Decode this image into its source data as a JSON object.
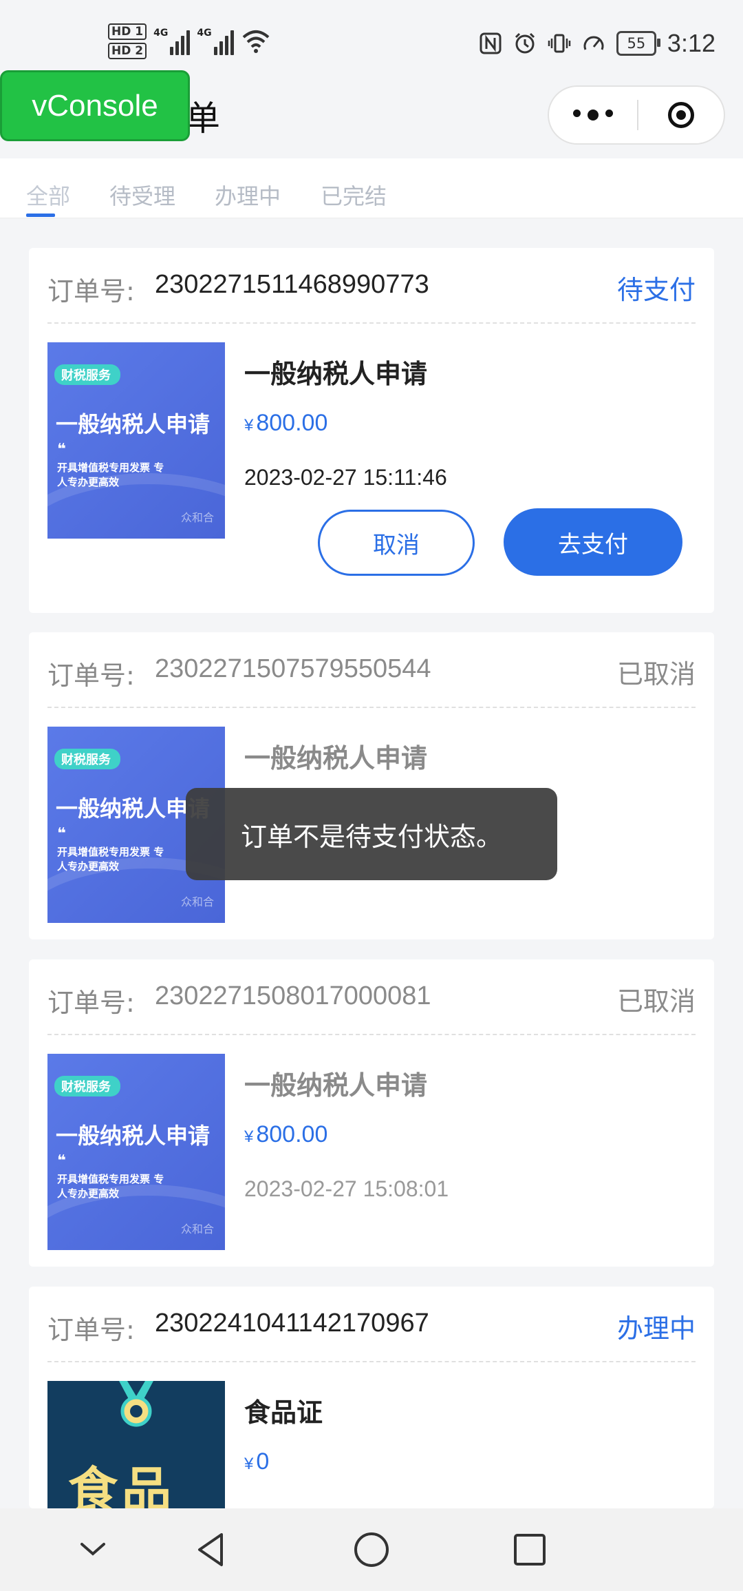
{
  "statusbar": {
    "hd1": "HD 1",
    "hd2": "HD 2",
    "net1": "4G",
    "net2": "4G",
    "battery": "55",
    "time": "3:12",
    "icons": [
      "nfc-icon",
      "alarm-icon",
      "vibrate-icon",
      "speed-icon",
      "wifi-icon",
      "signal-icon"
    ]
  },
  "header": {
    "title_visible": "单",
    "vconsole_label": "vConsole"
  },
  "tabs": [
    {
      "label": "全部"
    },
    {
      "label": "待受理"
    },
    {
      "label": "办理中"
    },
    {
      "label": "已完结"
    }
  ],
  "orders": [
    {
      "order_label": "订单号:",
      "order_no": "2302271511468990773",
      "status": "待支付",
      "product": "一般纳税人申请",
      "currency": "¥",
      "price": "800.00",
      "time": "2023-02-27 15:11:46",
      "cancel_label": "取消",
      "pay_label": "去支付",
      "thumb": {
        "tag": "财税服务",
        "title": "一般纳税人申请",
        "quote": "❝",
        "desc": "开具增值税专用发票 专人专办更高效",
        "logo": "众和合"
      }
    },
    {
      "order_label": "订单号:",
      "order_no": "2302271507579550544",
      "status": "已取消",
      "product": "一般纳税人申请",
      "thumb": {
        "tag": "财税服务",
        "title": "一般纳税人申请",
        "quote": "❝",
        "desc": "开具增值税专用发票 专人专办更高效",
        "logo": "众和合"
      }
    },
    {
      "order_label": "订单号:",
      "order_no": "2302271508017000081",
      "status": "已取消",
      "product": "一般纳税人申请",
      "currency": "¥",
      "price": "800.00",
      "time": "2023-02-27 15:08:01",
      "thumb": {
        "tag": "财税服务",
        "title": "一般纳税人申请",
        "quote": "❝",
        "desc": "开具增值税专用发票 专人专办更高效",
        "logo": "众和合"
      }
    },
    {
      "order_label": "订单号:",
      "order_no": "2302241041142170967",
      "status": "办理中",
      "product": "食品证",
      "currency": "¥",
      "price": "0",
      "thumb": {
        "title": "食品"
      }
    }
  ],
  "toast": "订单不是待支付状态。",
  "colors": {
    "accent": "#2b6fe6",
    "vconsole": "#22c245",
    "toast_bg": "#3c3c3c"
  }
}
